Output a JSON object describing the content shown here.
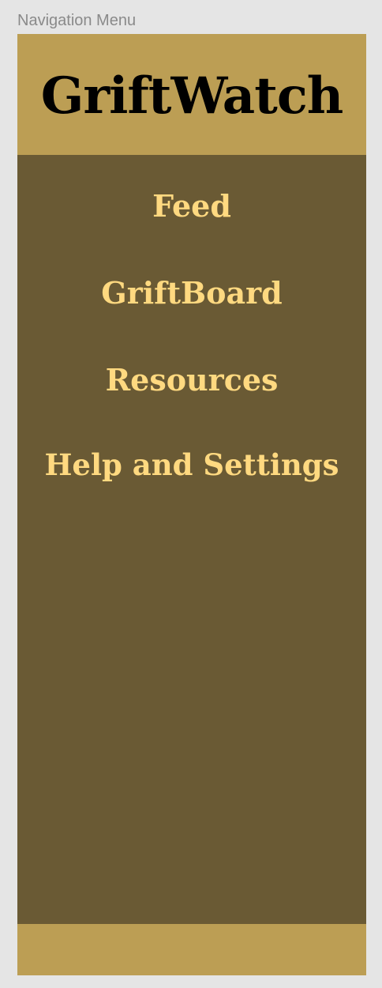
{
  "frame": {
    "label": "Navigation Menu"
  },
  "header": {
    "title": "GriftWatch"
  },
  "nav": {
    "items": [
      {
        "label": "Feed"
      },
      {
        "label": "GriftBoard"
      },
      {
        "label": "Resources"
      },
      {
        "label": "Help and Settings"
      }
    ]
  },
  "colors": {
    "header_bg": "#bc9e54",
    "menu_bg": "#6a5a34",
    "menu_text": "#ffd980",
    "title_text": "#000000"
  }
}
